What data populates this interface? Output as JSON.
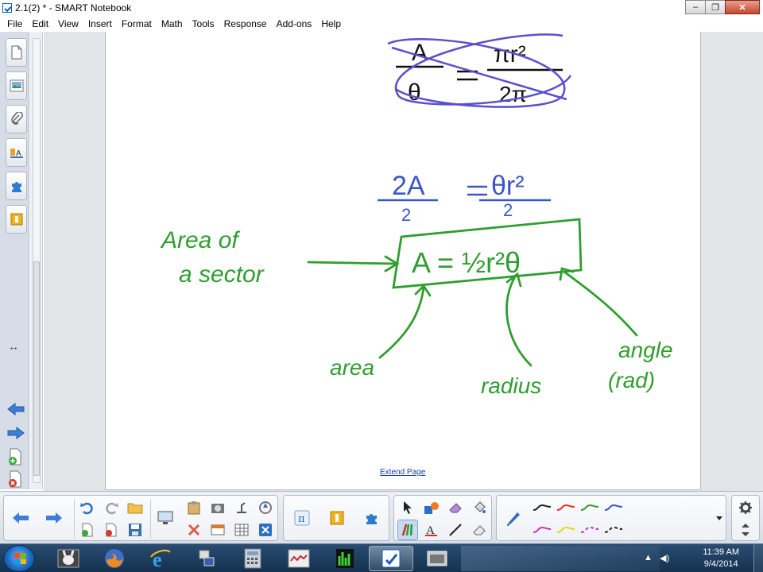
{
  "window": {
    "title": "2.1(2) * - SMART Notebook",
    "minimize": "‒",
    "maximize": "❐",
    "close": "✕"
  },
  "menu": [
    "File",
    "Edit",
    "View",
    "Insert",
    "Format",
    "Math",
    "Tools",
    "Response",
    "Add-ons",
    "Help"
  ],
  "canvas": {
    "extend_link": "Extend Page",
    "ink_color_green": "#2f9e2f",
    "ink_color_purple": "#5a4fcf",
    "ink_color_blue": "#3a55c8",
    "handwriting": {
      "crossed_numerator": "A",
      "crossed_denominator": "θ",
      "crossed_rhs_numerator": "πr²",
      "crossed_rhs_denominator": "2π",
      "scratch_lhs_num": "2A",
      "scratch_lhs_den": "2",
      "scratch_rhs_num": "θr²",
      "scratch_rhs_den": "2",
      "label_area_of": "Area of",
      "label_a_sector": "a sector",
      "formula": "A = ½r²θ",
      "label_area": "area",
      "label_radius": "radius",
      "label_angle": "angle",
      "label_rad": "(rad)"
    }
  },
  "taskbar": {
    "time": "11:39 AM",
    "date": "9/4/2014"
  }
}
